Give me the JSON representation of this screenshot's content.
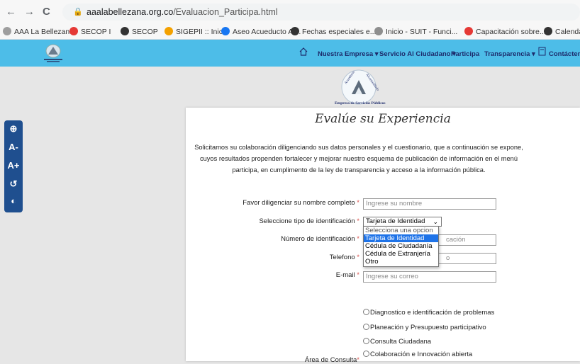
{
  "browser": {
    "back_glyph": "←",
    "forward_glyph": "→",
    "reload_glyph": "C",
    "url_domain": "aaalabellezana.org.co",
    "url_path": "/Evaluacion_Participa.html",
    "bookmarks": [
      {
        "label": "AAA La Bellezana",
        "color": "#9e9e9e"
      },
      {
        "label": "SECOP I",
        "color": "#e53935"
      },
      {
        "label": "SECOP",
        "color": "#333333"
      },
      {
        "label": "SIGEPII :: Inicio",
        "color": "#f4a100"
      },
      {
        "label": "Aseo Acueducto Al...",
        "color": "#1877f2"
      },
      {
        "label": "Fechas especiales e...",
        "color": "#333333"
      },
      {
        "label": "Inicio - SUIT - Funci...",
        "color": "#8e8e8e"
      },
      {
        "label": "Capacitación sobre...",
        "color": "#e53935"
      },
      {
        "label": "Calendar",
        "color": "#333333"
      }
    ]
  },
  "nav": {
    "home_icon": "home-icon",
    "items": [
      "Nuestra Empresa ▾",
      "Servicio Al Ciudadano ▾",
      "Participa",
      "Transparencia ▾",
      "Contácten"
    ]
  },
  "logo": {
    "arc_left": "Acueducto",
    "arc_right": "Alcantarillado",
    "caption": "Empresa de Servicios Públicos"
  },
  "form": {
    "title": "Evalúe su Experiencia",
    "intro": "Solicitamos su colaboración diligenciando sus datos personales y el cuestionario, que a continuación se expone, cuyos resultados propenden fortalecer y mejorar nuestro esquema de publicación de información en el menú participa, en cumplimento de la ley de transparencia y acceso a la información pública.",
    "required_mark": "*",
    "name_label": "Favor diligenciar su nombre completo",
    "name_placeholder": "Ingrese su nombre",
    "id_type_label": "Seleccione tipo de identificación",
    "id_type_selected": "Tarjeta de Identidad",
    "id_type_options": [
      "Selecciona una opcion",
      "Tarjeta de Identidad",
      "Cédula de Ciudadanía",
      "Cédula de Extranjería",
      "Otro"
    ],
    "id_number_label": "Número de identificación",
    "id_number_placeholder_visible": "cación",
    "phone_label": "Telefono",
    "phone_placeholder_visible": "o",
    "email_label": "E-mail",
    "email_placeholder": "Ingrese su correo",
    "area_label": "Área de Consulta",
    "area_options": [
      "Diagnostico e identificación de problemas",
      "Planeación y Presupuesto participativo",
      "Consulta Ciudadana",
      "Colaboración e Innovación abierta"
    ]
  },
  "accessibility": {
    "items": [
      "⊕",
      "A-",
      "A+",
      "↺",
      "◐"
    ]
  }
}
